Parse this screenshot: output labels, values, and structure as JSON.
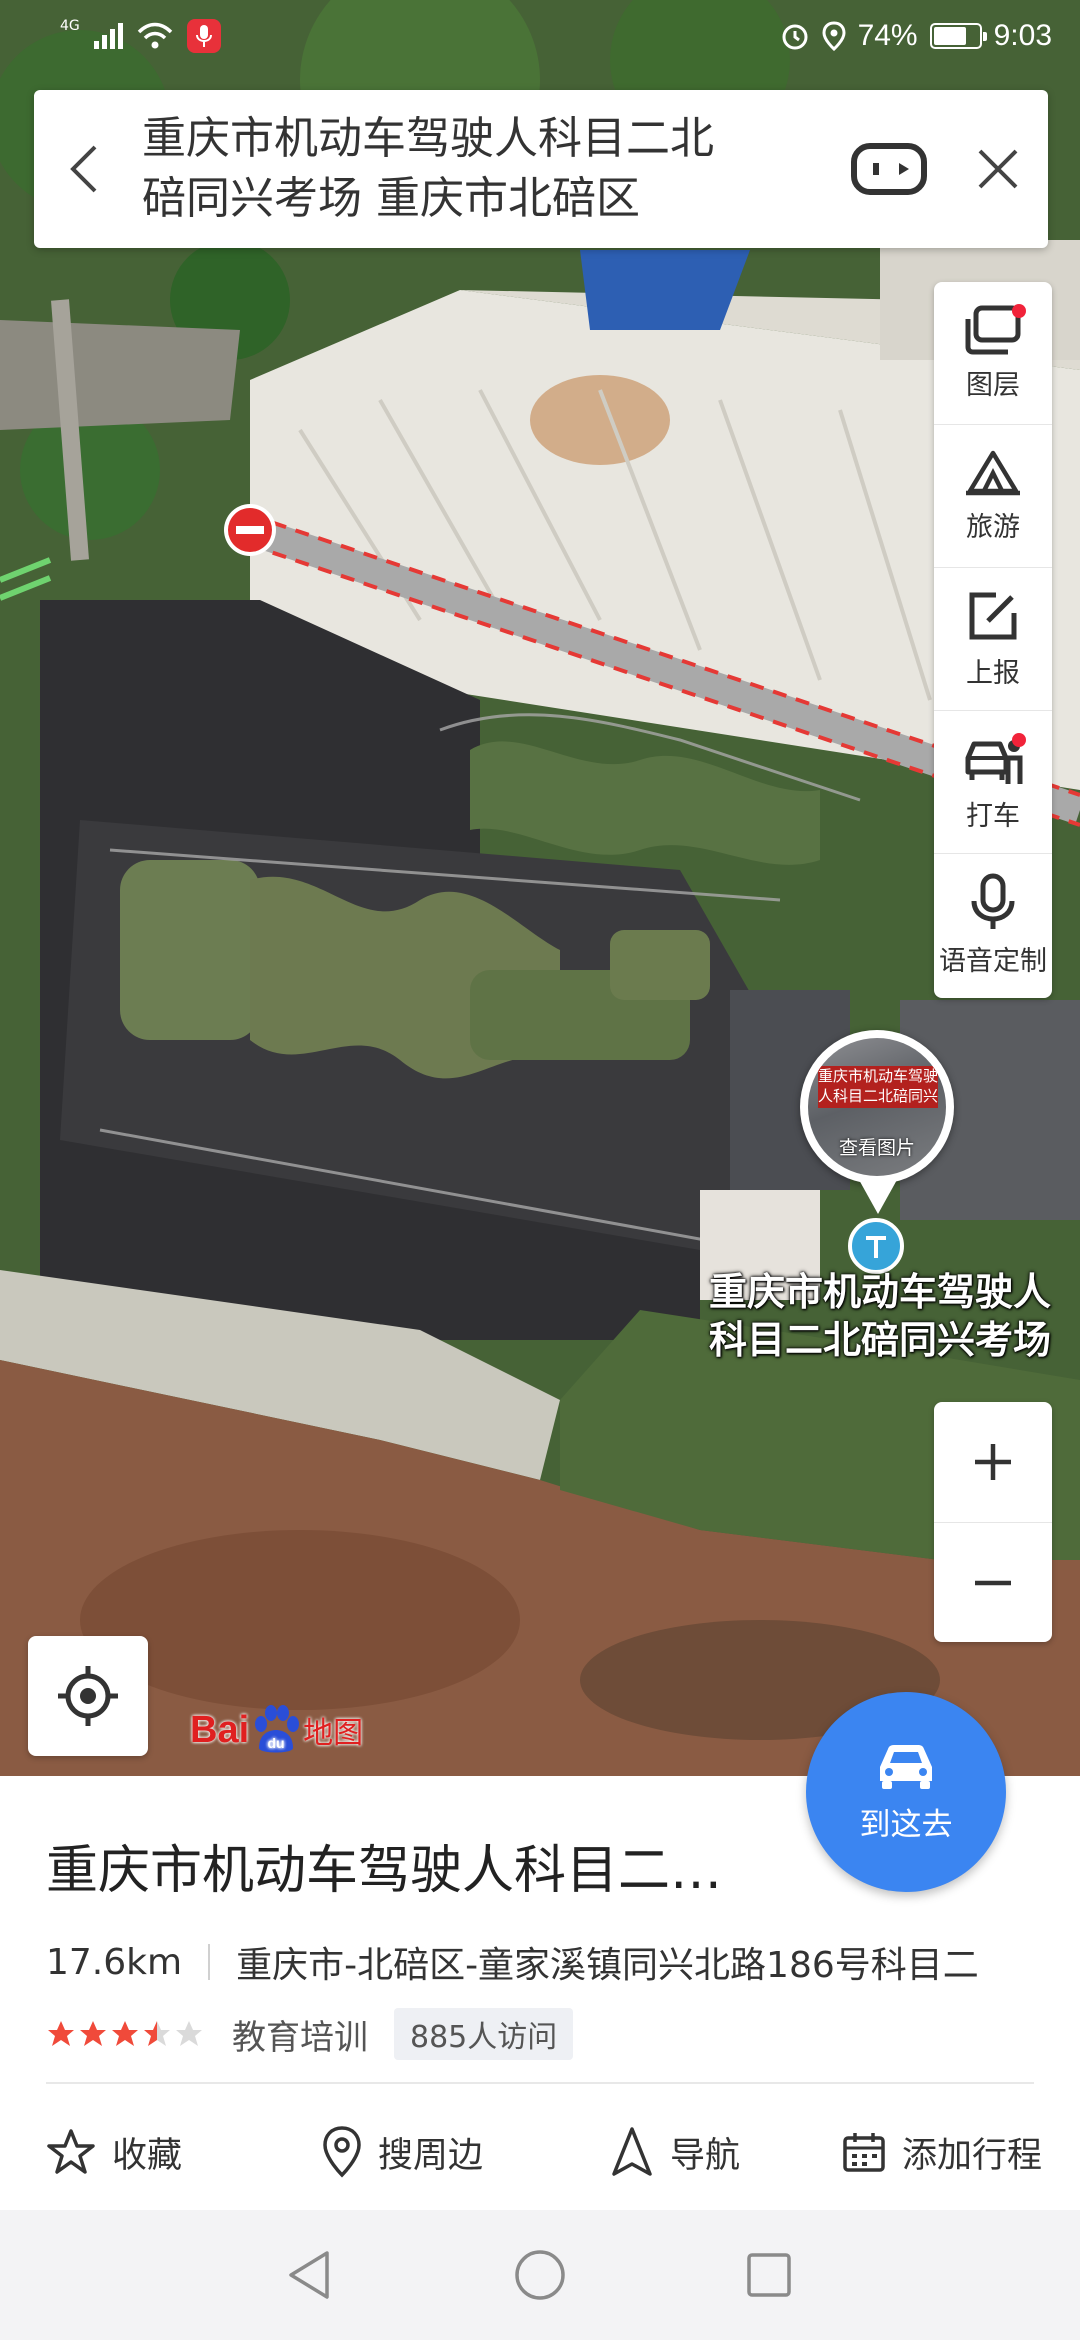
{
  "status_bar": {
    "network": "4G",
    "battery": "74%",
    "battery_level": 0.74,
    "time": "9:03"
  },
  "search": {
    "query_line1": "重庆市机动车驾驶人科目二北",
    "query_line2": "碚同兴考场 重庆市北碚区"
  },
  "toolbar": {
    "items": [
      {
        "label": "图层",
        "icon": "layers-icon",
        "badge": true
      },
      {
        "label": "旅游",
        "icon": "travel-icon",
        "badge": false
      },
      {
        "label": "上报",
        "icon": "report-icon",
        "badge": false
      },
      {
        "label": "打车",
        "icon": "taxi-icon",
        "badge": true
      },
      {
        "label": "语音定制",
        "icon": "microphone-icon",
        "badge": false
      }
    ]
  },
  "map": {
    "marker_photo_caption": "查看图片",
    "marker_photo_sign": "重庆市机动车驾驶人科目二北碚同兴考场",
    "marker_label_line1": "重庆市机动车驾驶人",
    "marker_label_line2": "科目二北碚同兴考场",
    "logo_text": "Bai",
    "logo_text2": "du",
    "logo_cn": "地图"
  },
  "go_button": {
    "label": "到这去"
  },
  "poi": {
    "title": "重庆市机动车驾驶人科目二…",
    "distance": "17.6km",
    "address": "重庆市-北碚区-童家溪镇同兴北路186号科目二",
    "rating": 3.5,
    "category": "教育培训",
    "visits": "885人访问"
  },
  "actions": [
    {
      "label": "收藏",
      "icon": "star-outline-icon"
    },
    {
      "label": "搜周边",
      "icon": "location-pin-icon"
    },
    {
      "label": "导航",
      "icon": "navigation-arrow-icon"
    },
    {
      "label": "添加行程",
      "icon": "calendar-icon"
    }
  ],
  "colors": {
    "accent": "#3b85f1",
    "badge_red": "#f1233a",
    "star": "#f04a3a",
    "route_red": "#e53935"
  }
}
